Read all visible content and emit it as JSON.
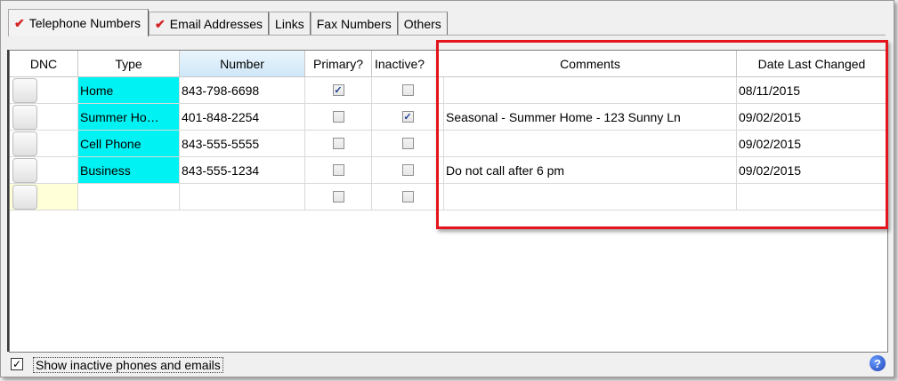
{
  "tabs": [
    {
      "label": "Telephone Numbers",
      "checked": true,
      "active": true
    },
    {
      "label": "Email Addresses",
      "checked": true,
      "active": false
    },
    {
      "label": "Links",
      "checked": false,
      "active": false
    },
    {
      "label": "Fax Numbers",
      "checked": false,
      "active": false
    },
    {
      "label": "Others",
      "checked": false,
      "active": false
    }
  ],
  "check_glyph": "✔",
  "grid": {
    "columns": {
      "dnc": "DNC",
      "type": "Type",
      "number": "Number",
      "primary": "Primary?",
      "inactive": "Inactive?",
      "comments": "Comments",
      "date": "Date Last Changed"
    },
    "rows": [
      {
        "type": "Home",
        "number": "843-798-6698",
        "primary": true,
        "inactive": false,
        "comments": "",
        "date": "08/11/2015"
      },
      {
        "type": "Summer Ho…",
        "number": "401-848-2254",
        "primary": false,
        "inactive": true,
        "comments": "Seasonal - Summer Home - 123 Sunny Ln",
        "date": "09/02/2015"
      },
      {
        "type": "Cell Phone",
        "number": "843-555-5555",
        "primary": false,
        "inactive": false,
        "comments": "",
        "date": "09/02/2015"
      },
      {
        "type": "Business",
        "number": "843-555-1234",
        "primary": false,
        "inactive": false,
        "comments": "Do not call after 6 pm",
        "date": "09/02/2015"
      },
      {
        "type": "",
        "number": "",
        "primary": false,
        "inactive": false,
        "comments": "",
        "date": "",
        "new_row": true
      }
    ]
  },
  "footer": {
    "show_inactive_label": "Show inactive phones and emails",
    "show_inactive_checked": true,
    "help_glyph": "?"
  },
  "colors": {
    "type_cell_bg": "#00f2f2",
    "highlight_border": "#e3141c",
    "check_red": "#d42222"
  }
}
